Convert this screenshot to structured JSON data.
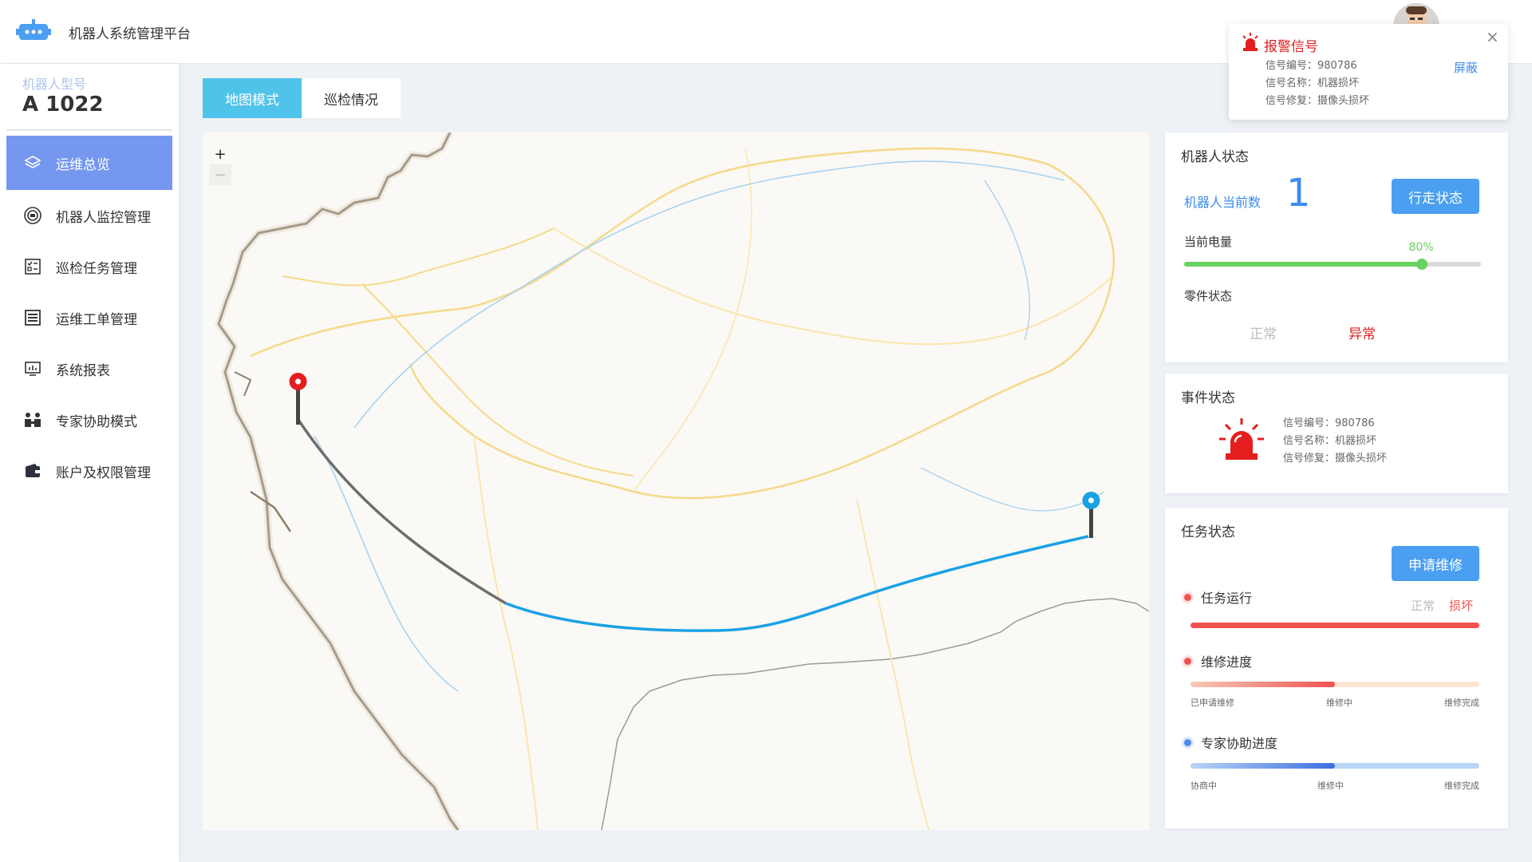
{
  "header": {
    "title": "机器人系统管理平台",
    "logo_icon": "robot-icon"
  },
  "sidebar": {
    "model_label": "机器人型号",
    "model_value": "A 1022",
    "items": [
      {
        "label": "运维总览",
        "icon": "layers-icon",
        "active": true
      },
      {
        "label": "机器人监控管理",
        "icon": "monitor-ring-icon"
      },
      {
        "label": "巡检任务管理",
        "icon": "checklist-icon"
      },
      {
        "label": "运维工单管理",
        "icon": "list-icon"
      },
      {
        "label": "系统报表",
        "icon": "report-screen-icon"
      },
      {
        "label": "专家协助模式",
        "icon": "people-icon"
      },
      {
        "label": "账户及权限管理",
        "icon": "wallet-icon"
      }
    ]
  },
  "tabs": [
    {
      "label": "地图模式",
      "active": true
    },
    {
      "label": "巡检情况"
    }
  ],
  "map": {
    "zoom_in": "+",
    "zoom_out": "−"
  },
  "robot_status": {
    "title": "机器人状态",
    "count_label": "机器人当前数",
    "count_value": "1",
    "walk_button": "行走状态",
    "battery_label": "当前电量",
    "battery_percent": "80%",
    "battery_level": 0.8,
    "parts_label": "零件状态",
    "parts_normal": "正常",
    "parts_abnormal": "异常"
  },
  "event_status": {
    "title": "事件状态",
    "lines": [
      "信号编号：980786",
      "信号名称：机器损坏",
      "信号修复：摄像头损坏"
    ]
  },
  "task_status": {
    "title": "任务状态",
    "repair_button": "申请维修",
    "run_label": "任务运行",
    "run_normal": "正常",
    "run_damaged": "损坏",
    "repair_label": "维修进度",
    "repair_level": 0.5,
    "repair_stages": [
      "已申请维修",
      "维修中",
      "维修完成"
    ],
    "expert_label": "专家协助进度",
    "expert_level": 0.5,
    "expert_stages": [
      "协商中",
      "维修中",
      "维修完成"
    ]
  },
  "alarm": {
    "title": "报警信号",
    "lines": [
      "信号编号：980786",
      "信号名称：机器损坏",
      "信号修复：摄像头损坏"
    ],
    "shield": "屏蔽",
    "close": "×"
  },
  "colors": {
    "accent": "#4a9ff0",
    "active_menu": "#7597f0",
    "tab_active": "#4fc3ea",
    "alarm": "#e02020",
    "battery": "#68d160"
  }
}
